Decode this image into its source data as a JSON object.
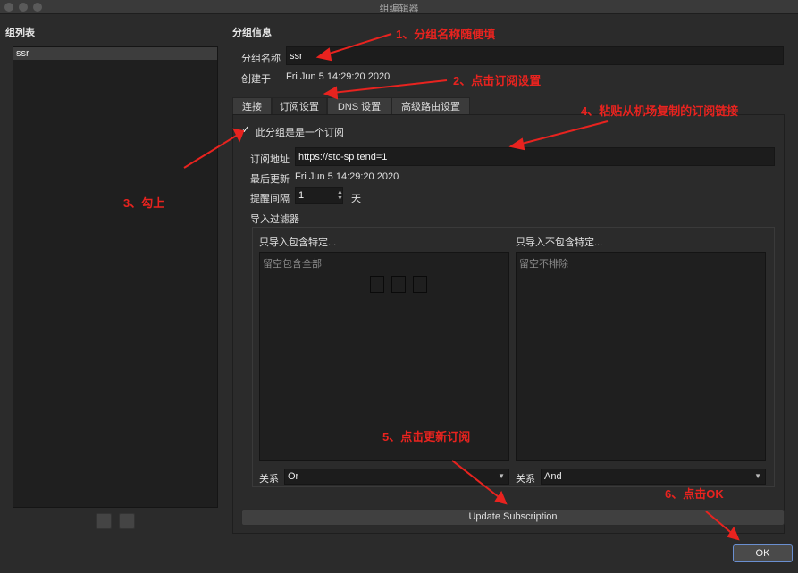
{
  "window": {
    "title": "组编辑器"
  },
  "sidebar": {
    "heading": "组列表",
    "items": [
      {
        "label": "ssr"
      }
    ]
  },
  "group_info": {
    "heading": "分组信息",
    "name_label": "分组名称",
    "name_value": "ssr",
    "created_label": "创建于",
    "created_value": "Fri Jun 5 14:29:20 2020"
  },
  "tabs": [
    {
      "label": "连接"
    },
    {
      "label": "订阅设置"
    },
    {
      "label": "DNS 设置"
    },
    {
      "label": "高级路由设置"
    }
  ],
  "subscription": {
    "is_subscription_label": "此分组是是一个订阅",
    "is_subscription_checked": true,
    "checkbox_glyph": "✓",
    "url_label": "订阅地址",
    "url_value": "https://stc-sp                                        tend=1",
    "last_update_label": "最后更新",
    "last_update_value": "Fri Jun 5 14:29:20 2020",
    "interval_label": "提醒间隔",
    "interval_value": "1",
    "interval_unit": "天",
    "filter_heading": "导入过滤器",
    "include_heading": "只导入包含特定...",
    "include_placeholder": "留空包含全部",
    "exclude_heading": "只导入不包含特定...",
    "exclude_placeholder": "留空不排除",
    "include_relation_label": "关系",
    "include_relation_value": "Or",
    "exclude_relation_label": "关系",
    "exclude_relation_value": "And",
    "update_button": "Update Subscription"
  },
  "ok_button": "OK",
  "annotations": {
    "step1": "1、分组名称随便填",
    "step2": "2、点击订阅设置",
    "step3": "3、勾上",
    "step4": "4、粘贴从机场复制的订阅链接",
    "step5": "5、点击更新订阅",
    "step6": "6、点击OK"
  },
  "colors": {
    "annotation": "#e8231f",
    "background": "#2b2b2b",
    "ok_border": "#6a8fd0"
  }
}
